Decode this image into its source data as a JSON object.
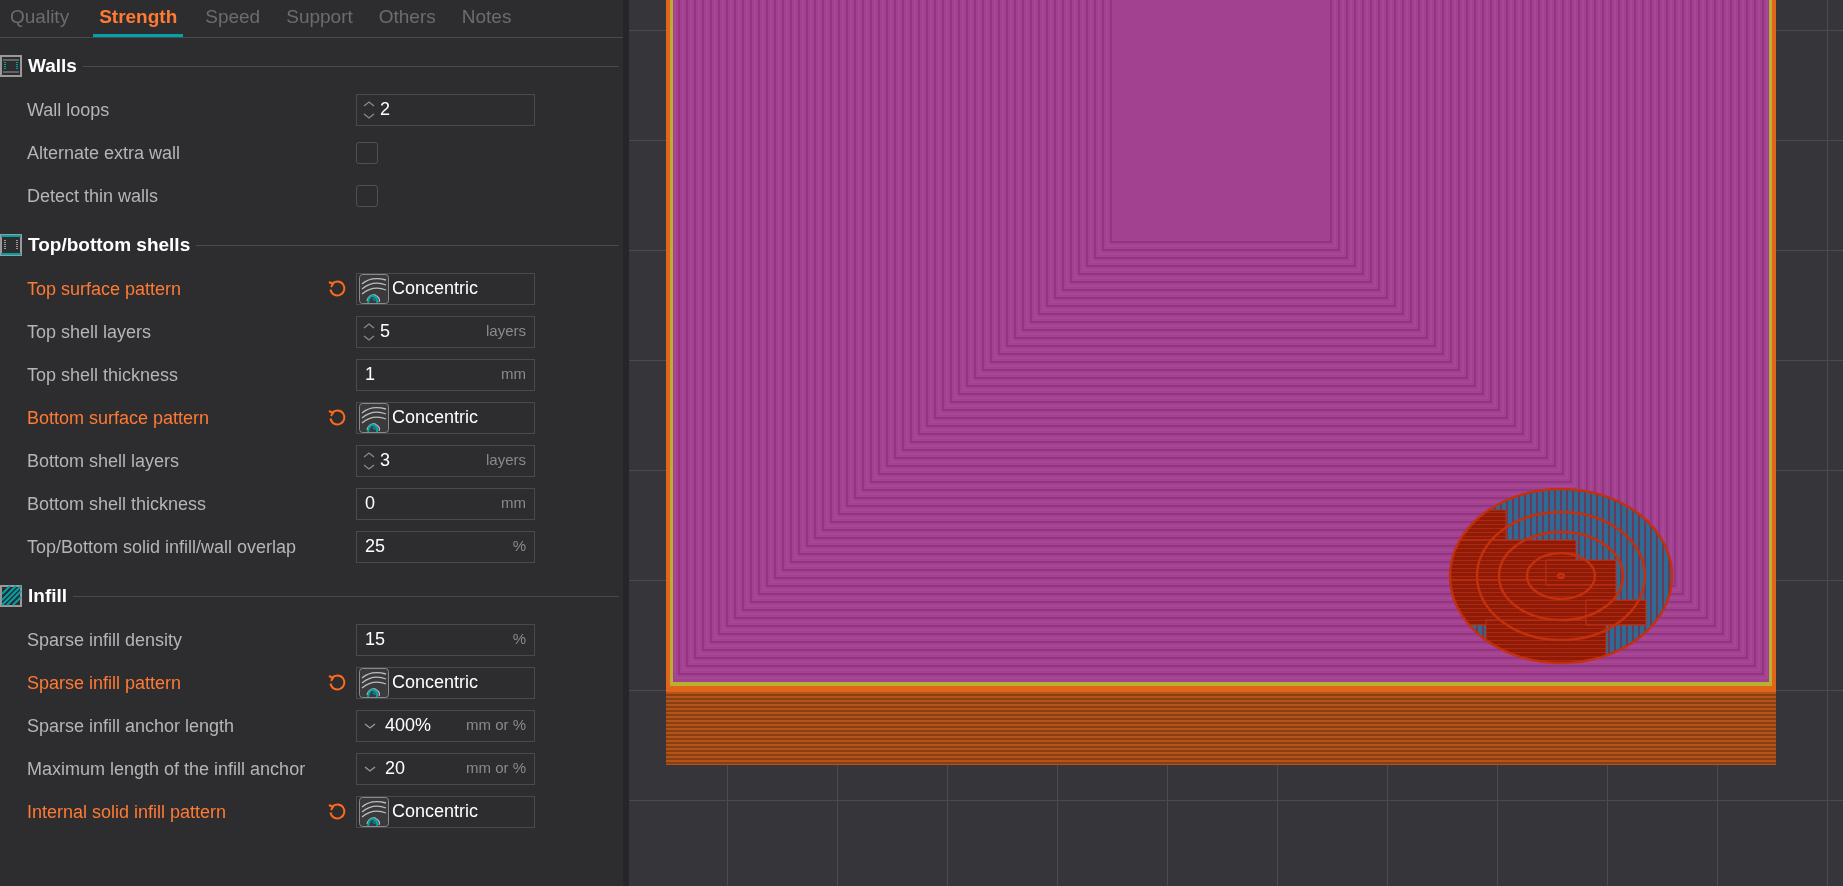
{
  "tabs": [
    {
      "label": "Quality",
      "selected": false
    },
    {
      "label": "Strength",
      "selected": true
    },
    {
      "label": "Speed",
      "selected": false
    },
    {
      "label": "Support",
      "selected": false
    },
    {
      "label": "Others",
      "selected": false
    },
    {
      "label": "Notes",
      "selected": false
    }
  ],
  "sections": [
    {
      "title": "Walls",
      "rows": [
        {
          "kind": "spin",
          "label": "Wall loops",
          "modified": false,
          "value": "2"
        },
        {
          "kind": "checkbox",
          "label": "Alternate extra wall",
          "modified": false,
          "checked": false
        },
        {
          "kind": "checkbox",
          "label": "Detect thin walls",
          "modified": false,
          "checked": false
        }
      ]
    },
    {
      "title": "Top/bottom shells",
      "rows": [
        {
          "kind": "pattern",
          "label": "Top surface pattern",
          "modified": true,
          "value": "Concentric"
        },
        {
          "kind": "spin",
          "label": "Top shell layers",
          "modified": false,
          "value": "5",
          "unit": "layers"
        },
        {
          "kind": "number",
          "label": "Top shell thickness",
          "modified": false,
          "value": "1",
          "unit": "mm"
        },
        {
          "kind": "pattern",
          "label": "Bottom surface pattern",
          "modified": true,
          "value": "Concentric"
        },
        {
          "kind": "spin",
          "label": "Bottom shell layers",
          "modified": false,
          "value": "3",
          "unit": "layers"
        },
        {
          "kind": "number",
          "label": "Bottom shell thickness",
          "modified": false,
          "value": "0",
          "unit": "mm"
        },
        {
          "kind": "number",
          "label": "Top/Bottom solid infill/wall overlap",
          "modified": false,
          "value": "25",
          "unit": "%"
        }
      ]
    },
    {
      "title": "Infill",
      "rows": [
        {
          "kind": "number",
          "label": "Sparse infill density",
          "modified": false,
          "value": "15",
          "unit": "%"
        },
        {
          "kind": "pattern",
          "label": "Sparse infill pattern",
          "modified": true,
          "value": "Concentric"
        },
        {
          "kind": "dropdown",
          "label": "Sparse infill anchor length",
          "modified": false,
          "value": "400%",
          "unit": "mm or %"
        },
        {
          "kind": "dropdown",
          "label": "Maximum length of the infill anchor",
          "modified": false,
          "value": "20",
          "unit": "mm or %"
        },
        {
          "kind": "pattern",
          "label": "Internal solid infill pattern",
          "modified": true,
          "value": "Concentric"
        }
      ]
    }
  ]
}
